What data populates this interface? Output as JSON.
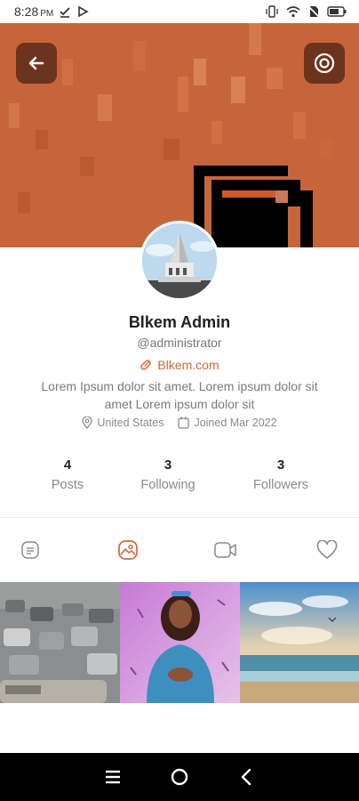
{
  "status_bar": {
    "time": "8:28",
    "ampm": "PM",
    "icons": [
      "check-download-icon",
      "play-store-icon",
      "vibrate-icon",
      "wifi-icon",
      "no-sim-icon",
      "battery-icon"
    ]
  },
  "header": {
    "back_icon": "arrow-left-icon",
    "settings_icon": "settings-circle-icon",
    "cover_color": "#c7653a"
  },
  "profile": {
    "name": "Blkem Admin",
    "handle": "@administrator",
    "website": "Blkem.com",
    "bio": "Lorem Ipsum dolor sit amet. Lorem ipsum dolor sit amet Lorem ipsum dolor sit",
    "location": "United States",
    "joined": "Joined Mar 2022"
  },
  "stats": [
    {
      "count": "4",
      "label": "Posts"
    },
    {
      "count": "3",
      "label": "Following"
    },
    {
      "count": "3",
      "label": "Followers"
    }
  ],
  "tabs": [
    {
      "name": "posts-tab",
      "icon": "document-icon",
      "active": false
    },
    {
      "name": "photos-tab",
      "icon": "image-icon",
      "active": true
    },
    {
      "name": "videos-tab",
      "icon": "video-camera-icon",
      "active": false
    },
    {
      "name": "likes-tab",
      "icon": "heart-icon",
      "active": false
    }
  ],
  "grid_items": [
    "traffic-jam-photo",
    "woman-teal-shirt-photo",
    "beach-sunset-photo"
  ],
  "colors": {
    "accent": "#d2683d",
    "text_muted": "#8a8a8a"
  },
  "nav": [
    "recents-icon",
    "home-icon",
    "back-icon"
  ]
}
